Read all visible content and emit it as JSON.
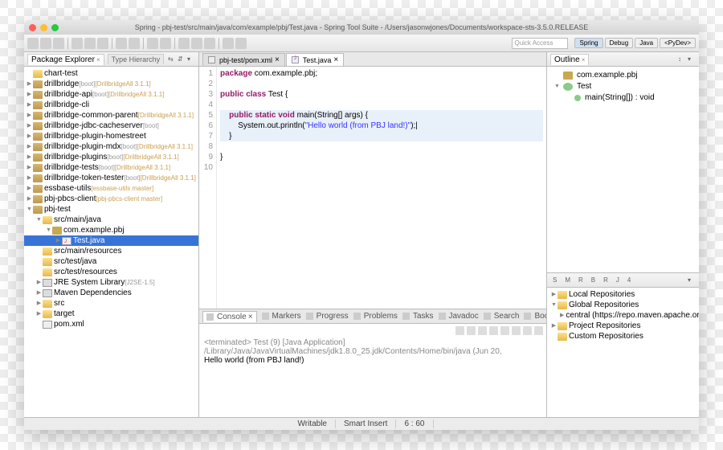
{
  "window": {
    "title": "Spring - pbj-test/src/main/java/com/example/pbj/Test.java - Spring Tool Suite - /Users/jasonwjones/Documents/workspace-sts-3.5.0.RELEASE"
  },
  "quickAccess": "Quick Access",
  "perspectives": [
    {
      "label": "Spring",
      "active": true
    },
    {
      "label": "Debug",
      "active": false
    },
    {
      "label": "Java",
      "active": false
    },
    {
      "label": "<PyDev>",
      "active": false
    }
  ],
  "explorer": {
    "title": "Package Explorer",
    "secondaryTab": "Type Hierarchy",
    "items": [
      {
        "d": 0,
        "exp": null,
        "ico": "folder",
        "label": "chart-test"
      },
      {
        "d": 0,
        "exp": "c",
        "ico": "prj",
        "label": "drillbridge",
        "suffix": "[boot]",
        "ws": "[DrillbridgeAll 3.1.1]"
      },
      {
        "d": 0,
        "exp": "c",
        "ico": "prj",
        "label": "drillbridge-api",
        "suffix": "[boot]",
        "ws": "[DrillbridgeAll 3.1.1]"
      },
      {
        "d": 0,
        "exp": "c",
        "ico": "prj",
        "label": "drillbridge-cli"
      },
      {
        "d": 0,
        "exp": "c",
        "ico": "prj",
        "label": "drillbridge-common-parent",
        "ws": "[DrillbridgeAll 3.1.1]"
      },
      {
        "d": 0,
        "exp": "c",
        "ico": "prj",
        "label": "drillbridge-jdbc-cacheserver",
        "suffix": "[boot]"
      },
      {
        "d": 0,
        "exp": "c",
        "ico": "prj",
        "label": "drillbridge-plugin-homestreet"
      },
      {
        "d": 0,
        "exp": "c",
        "ico": "prj",
        "label": "drillbridge-plugin-mdx",
        "suffix": "[boot]",
        "ws": "[DrillbridgeAll 3.1.1]"
      },
      {
        "d": 0,
        "exp": "c",
        "ico": "prj",
        "label": "drillbridge-plugins",
        "suffix": "[boot]",
        "ws": "[DrillbridgeAll 3.1.1]"
      },
      {
        "d": 0,
        "exp": "c",
        "ico": "prj",
        "label": "drillbridge-tests",
        "suffix": "[boot]",
        "ws": "[DrillbridgeAll 3.1.1]"
      },
      {
        "d": 0,
        "exp": "c",
        "ico": "prj",
        "label": "drillbridge-token-tester",
        "suffix": "[boot]",
        "ws": "[DrillbridgeAll 3.1.1]"
      },
      {
        "d": 0,
        "exp": "c",
        "ico": "prj",
        "label": "essbase-utils",
        "ws": "[essbase-utils master]"
      },
      {
        "d": 0,
        "exp": "c",
        "ico": "prj",
        "label": "pbj-pbcs-client",
        "ws": "[pbj-pbcs-client master]"
      },
      {
        "d": 0,
        "exp": "o",
        "ico": "prj",
        "label": "pbj-test"
      },
      {
        "d": 1,
        "exp": "o",
        "ico": "folder",
        "label": "src/main/java"
      },
      {
        "d": 2,
        "exp": "o",
        "ico": "pkg",
        "label": "com.example.pbj"
      },
      {
        "d": 3,
        "exp": "c",
        "ico": "java",
        "label": "Test.java",
        "sel": true
      },
      {
        "d": 1,
        "exp": null,
        "ico": "folder",
        "label": "src/main/resources"
      },
      {
        "d": 1,
        "exp": null,
        "ico": "folder",
        "label": "src/test/java"
      },
      {
        "d": 1,
        "exp": null,
        "ico": "folder",
        "label": "src/test/resources"
      },
      {
        "d": 1,
        "exp": "c",
        "ico": "jar",
        "label": "JRE System Library",
        "suffix": "[J2SE-1.5]"
      },
      {
        "d": 1,
        "exp": "c",
        "ico": "jar",
        "label": "Maven Dependencies"
      },
      {
        "d": 1,
        "exp": "c",
        "ico": "folder",
        "label": "src"
      },
      {
        "d": 1,
        "exp": "c",
        "ico": "folder",
        "label": "target"
      },
      {
        "d": 1,
        "exp": null,
        "ico": "xml",
        "label": "pom.xml"
      }
    ]
  },
  "editorTabs": [
    {
      "label": "pbj-test/pom.xml",
      "active": false
    },
    {
      "label": "Test.java",
      "active": true
    }
  ],
  "code": {
    "lines": [
      {
        "n": 1,
        "html": "<span class='kw'>package</span> com.example.pbj;"
      },
      {
        "n": 2,
        "html": ""
      },
      {
        "n": 3,
        "html": "<span class='kw'>public class</span> <span class='typ'>Test</span> {"
      },
      {
        "n": 4,
        "html": ""
      },
      {
        "n": 5,
        "html": "    <span class='kw'>public static void</span> main(String[] args) {",
        "hl": true
      },
      {
        "n": 6,
        "html": "        System.out.println(<span class='str'>\"Hello world (from PBJ land!)\"</span>);|",
        "hl": true
      },
      {
        "n": 7,
        "html": "    }",
        "hl": true
      },
      {
        "n": 8,
        "html": ""
      },
      {
        "n": 9,
        "html": "}"
      },
      {
        "n": 10,
        "html": ""
      }
    ]
  },
  "consoleTabs": [
    "Console",
    "Markers",
    "Progress",
    "Problems",
    "Tasks",
    "Javadoc",
    "Search",
    "Bookmarks"
  ],
  "consoleActive": "Console",
  "console": {
    "header": "<terminated> Test (9) [Java Application] /Library/Java/JavaVirtualMachines/jdk1.8.0_25.jdk/Contents/Home/bin/java (Jun 20,",
    "output": "Hello world (from PBJ land!)"
  },
  "outline": {
    "title": "Outline",
    "items": [
      {
        "d": 0,
        "ico": "pkg",
        "label": "com.example.pbj"
      },
      {
        "d": 0,
        "ico": "cls",
        "label": "Test",
        "exp": "o"
      },
      {
        "d": 1,
        "ico": "meth",
        "label": "main(String[]) : void"
      }
    ]
  },
  "maven": {
    "tabs": [
      "S",
      "M",
      "R",
      "B",
      "R",
      "J",
      "4"
    ],
    "repos": [
      {
        "d": 0,
        "exp": "c",
        "label": "Local Repositories"
      },
      {
        "d": 0,
        "exp": "o",
        "label": "Global Repositories"
      },
      {
        "d": 1,
        "exp": "c",
        "label": "central (https://repo.maven.apache.org/maven"
      },
      {
        "d": 0,
        "exp": "c",
        "label": "Project Repositories"
      },
      {
        "d": 0,
        "exp": null,
        "label": "Custom Repositories"
      }
    ]
  },
  "status": {
    "writable": "Writable",
    "insert": "Smart Insert",
    "pos": "6 : 60"
  }
}
